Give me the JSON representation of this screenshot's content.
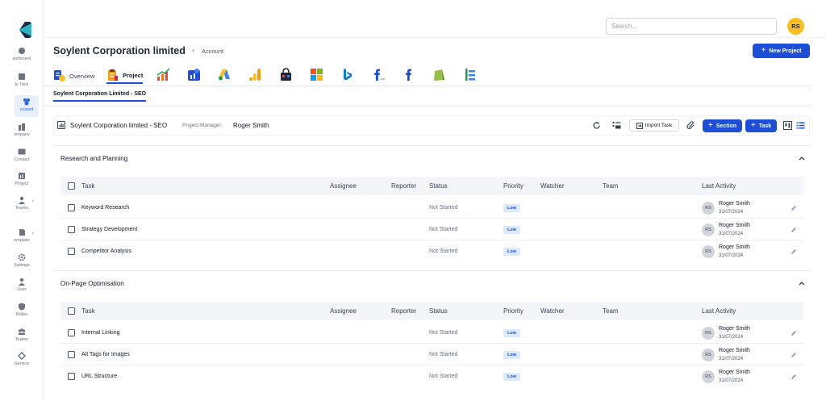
{
  "sidebar": {
    "items": [
      {
        "label": "ashboard",
        "icon": "dashboard-icon"
      },
      {
        "label": "ly Task",
        "icon": "task-icon"
      },
      {
        "label": "ccount",
        "icon": "account-icon",
        "active": true
      },
      {
        "label": "ompany",
        "icon": "company-icon"
      },
      {
        "label": "Contact",
        "icon": "contact-icon"
      },
      {
        "label": "Project",
        "icon": "project-icon"
      },
      {
        "label": "Teams",
        "icon": "teams-icon",
        "chevron": "›"
      },
      {
        "label": "emplate",
        "icon": "template-icon",
        "chevron": "›"
      },
      {
        "label": "Settings",
        "icon": "settings-icon"
      },
      {
        "label": "User",
        "icon": "user-icon"
      },
      {
        "label": "Roles",
        "icon": "roles-icon"
      },
      {
        "label": "Teams",
        "icon": "teams-icon"
      },
      {
        "label": "Service",
        "icon": "service-icon"
      }
    ]
  },
  "topbar": {
    "search_placeholder": "Search...",
    "avatar_initials": "RS"
  },
  "header": {
    "title": "Soylent Corporation limited",
    "breadcrumb_sep": "›",
    "breadcrumb": "Account",
    "new_project_label": "New Project"
  },
  "tabs": {
    "overview": "Overview",
    "project": "Project",
    "app_icons": [
      "analytics-chart-icon",
      "data-studio-icon",
      "google-ads-icon",
      "google-analytics-icon",
      "shopping-icon",
      "microsoft-icon",
      "bing-icon",
      "facebook-ads-icon",
      "facebook-icon",
      "shopify-icon",
      "tag-manager-icon"
    ]
  },
  "subtab": "Soylent Corporation Limited - SEO",
  "project_bar": {
    "name": "Soylent Corporation limited - SEO",
    "manager_label": "Project Manager:",
    "manager_value": "Roger Smith",
    "import_label": "Import Task",
    "section_label": "Section",
    "task_label": "Task"
  },
  "columns": {
    "task": "Task",
    "assignee": "Assignee",
    "reporter": "Reporter",
    "status": "Status",
    "priority": "Priority",
    "watcher": "Watcher",
    "team": "Team",
    "last_activity": "Last Activity"
  },
  "sections": [
    {
      "title": "Research and Planning",
      "rows": [
        {
          "task": "Keyword Research",
          "status": "Not Started",
          "priority": "Low",
          "initials": "RS",
          "name": "Roger Smith",
          "date": "31/07/2024"
        },
        {
          "task": "Strategy Development",
          "status": "Not Started",
          "priority": "Low",
          "initials": "RS",
          "name": "Roger Smith",
          "date": "31/07/2024"
        },
        {
          "task": "Competitor Analysis",
          "status": "Not Started",
          "priority": "Low",
          "initials": "RS",
          "name": "Roger Smith",
          "date": "31/07/2024"
        }
      ]
    },
    {
      "title": "On-Page Optimisation",
      "rows": [
        {
          "task": "Internal Linking",
          "status": "Not Started",
          "priority": "Low",
          "initials": "RS",
          "name": "Roger Smith",
          "date": "31/07/2024"
        },
        {
          "task": "Alt Tags for Images",
          "status": "Not Started",
          "priority": "Low",
          "initials": "RS",
          "name": "Roger Smith",
          "date": "31/07/2024"
        },
        {
          "task": "URL Structure",
          "status": "Not Started",
          "priority": "Low",
          "initials": "RS",
          "name": "Roger Smith",
          "date": "31/07/2024"
        }
      ]
    }
  ],
  "colors": {
    "primary": "#1d4ed8",
    "avatar": "#fbbf24",
    "badge_bg": "#dbeafe"
  }
}
